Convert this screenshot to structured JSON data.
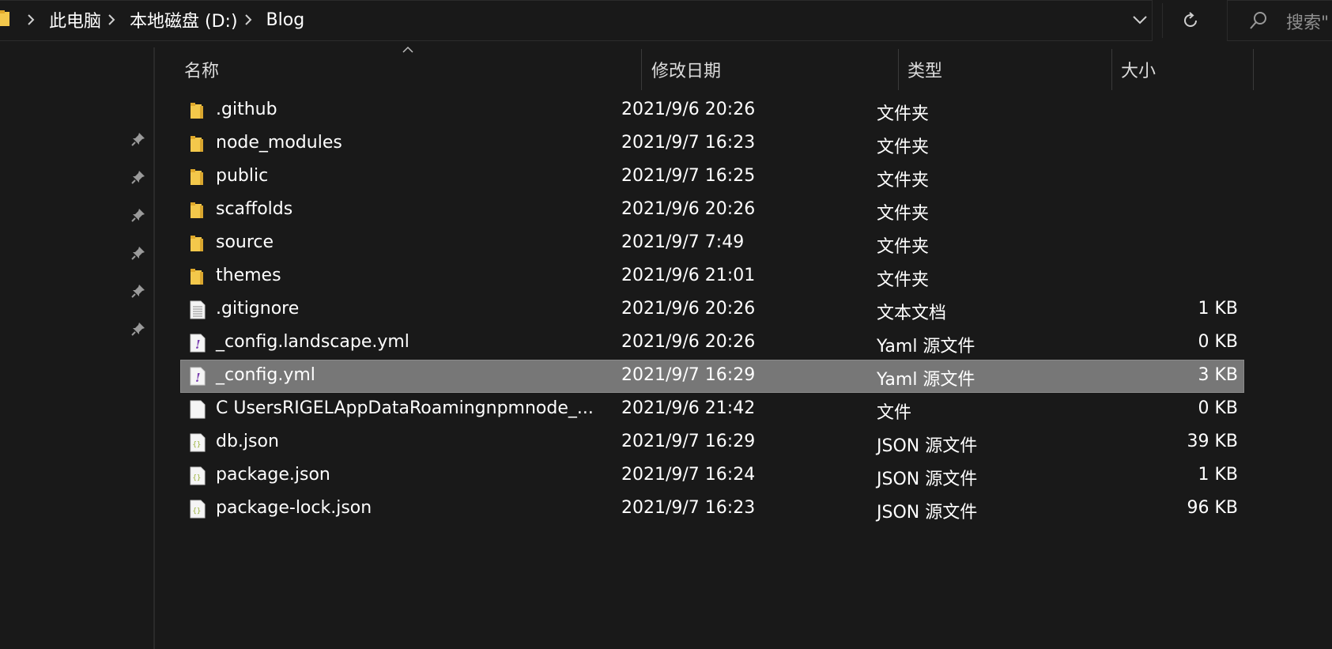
{
  "breadcrumb": [
    "此电脑",
    "本地磁盘 (D:)",
    "Blog"
  ],
  "search": {
    "placeholder": "搜索\""
  },
  "columns": {
    "name": "名称",
    "date": "修改日期",
    "type": "类型",
    "size": "大小"
  },
  "files": [
    {
      "icon": "folder-icon",
      "name": ".github",
      "date": "2021/9/6 20:26",
      "type": "文件夹",
      "size": ""
    },
    {
      "icon": "folder-icon",
      "name": "node_modules",
      "date": "2021/9/7 16:23",
      "type": "文件夹",
      "size": ""
    },
    {
      "icon": "folder-icon",
      "name": "public",
      "date": "2021/9/7 16:25",
      "type": "文件夹",
      "size": ""
    },
    {
      "icon": "folder-icon",
      "name": "scaffolds",
      "date": "2021/9/6 20:26",
      "type": "文件夹",
      "size": ""
    },
    {
      "icon": "folder-icon",
      "name": "source",
      "date": "2021/9/7 7:49",
      "type": "文件夹",
      "size": ""
    },
    {
      "icon": "folder-icon",
      "name": "themes",
      "date": "2021/9/6 21:01",
      "type": "文件夹",
      "size": ""
    },
    {
      "icon": "text-file-icon",
      "name": ".gitignore",
      "date": "2021/9/6 20:26",
      "type": "文本文档",
      "size": "1 KB"
    },
    {
      "icon": "yaml-file-icon",
      "name": "_config.landscape.yml",
      "date": "2021/9/6 20:26",
      "type": "Yaml 源文件",
      "size": "0 KB"
    },
    {
      "icon": "yaml-file-icon",
      "name": "_config.yml",
      "date": "2021/9/7 16:29",
      "type": "Yaml 源文件",
      "size": "3 KB",
      "selected": true
    },
    {
      "icon": "blank-file-icon",
      "name": "C   UsersRIGELAppDataRoamingnpmnode_...",
      "date": "2021/9/6 21:42",
      "type": "文件",
      "size": "0 KB"
    },
    {
      "icon": "json-file-icon",
      "name": "db.json",
      "date": "2021/9/7 16:29",
      "type": "JSON 源文件",
      "size": "39 KB"
    },
    {
      "icon": "json-file-icon",
      "name": "package.json",
      "date": "2021/9/7 16:24",
      "type": "JSON 源文件",
      "size": "1 KB"
    },
    {
      "icon": "json-file-icon",
      "name": "package-lock.json",
      "date": "2021/9/7 16:23",
      "type": "JSON 源文件",
      "size": "96 KB"
    }
  ],
  "colors": {
    "background": "#191919",
    "selected_row": "#777777",
    "folder": "#f3c84b",
    "yaml_mark": "#7a3fb0",
    "json_mark": "#9bb33a"
  }
}
